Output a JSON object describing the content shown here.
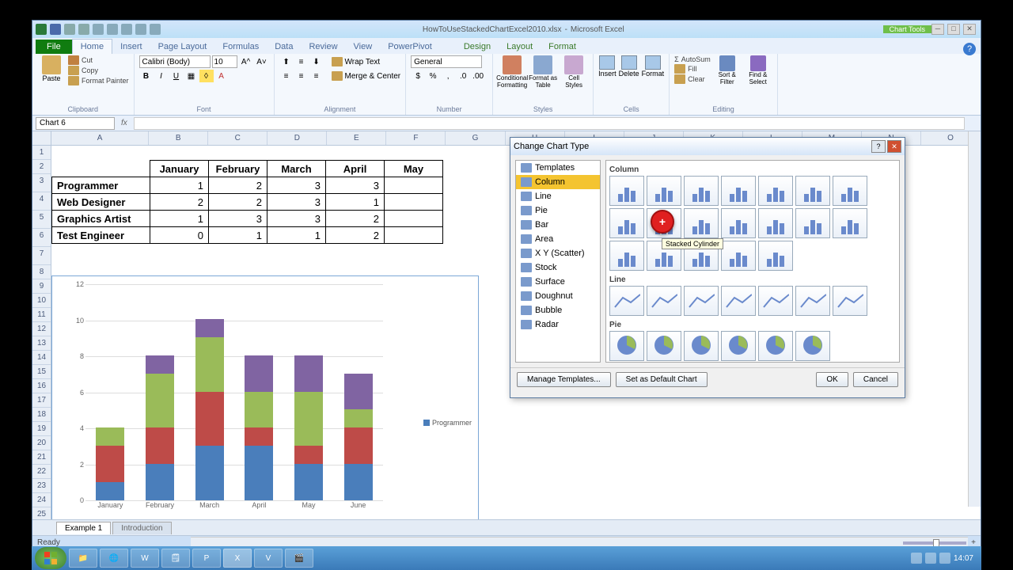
{
  "app": {
    "filename": "HowToUseStackedChartExcel2010.xlsx",
    "app_name": "Microsoft Excel",
    "context_tab": "Chart Tools"
  },
  "ribbon_tabs": [
    "File",
    "Home",
    "Insert",
    "Page Layout",
    "Formulas",
    "Data",
    "Review",
    "View",
    "PowerPivot"
  ],
  "context_tabs": [
    "Design",
    "Layout",
    "Format"
  ],
  "ribbon": {
    "clipboard": {
      "label": "Clipboard",
      "paste": "Paste",
      "cut": "Cut",
      "copy": "Copy",
      "format_painter": "Format Painter"
    },
    "font": {
      "label": "Font",
      "name": "Calibri (Body)",
      "size": "10"
    },
    "alignment": {
      "label": "Alignment",
      "wrap": "Wrap Text",
      "merge": "Merge & Center"
    },
    "number": {
      "label": "Number",
      "format": "General"
    },
    "styles": {
      "label": "Styles",
      "cond": "Conditional Formatting",
      "table": "Format as Table",
      "cell": "Cell Styles"
    },
    "cells": {
      "label": "Cells",
      "insert": "Insert",
      "delete": "Delete",
      "format": "Format"
    },
    "editing": {
      "label": "Editing",
      "sum": "AutoSum",
      "fill": "Fill",
      "clear": "Clear",
      "sort": "Sort & Filter",
      "find": "Find & Select"
    }
  },
  "name_box": "Chart 6",
  "columns": [
    "A",
    "B",
    "C",
    "D",
    "E",
    "F",
    "G",
    "H",
    "I",
    "J",
    "K",
    "L",
    "M",
    "N",
    "O"
  ],
  "row_count": 28,
  "table": {
    "months": [
      "January",
      "February",
      "March",
      "April",
      "May"
    ],
    "rows": [
      {
        "label": "Programmer",
        "values": [
          1,
          2,
          3,
          3
        ]
      },
      {
        "label": "Web Designer",
        "values": [
          2,
          2,
          3,
          1
        ]
      },
      {
        "label": "Graphics Artist",
        "values": [
          1,
          3,
          3,
          2
        ]
      },
      {
        "label": "Test Engineer",
        "values": [
          0,
          1,
          1,
          2
        ]
      }
    ]
  },
  "chart_data": {
    "type": "bar",
    "stacked": true,
    "categories": [
      "January",
      "February",
      "March",
      "April",
      "May",
      "June"
    ],
    "series": [
      {
        "name": "Programmer",
        "values": [
          1,
          2,
          3,
          3,
          2,
          2
        ],
        "color": "#4a7ebb"
      },
      {
        "name": "Web Designer",
        "values": [
          2,
          2,
          3,
          1,
          1,
          2
        ],
        "color": "#be4b48"
      },
      {
        "name": "Graphics Artist",
        "values": [
          1,
          3,
          3,
          2,
          3,
          1
        ],
        "color": "#9abb59"
      },
      {
        "name": "Test Engineer",
        "values": [
          0,
          1,
          1,
          2,
          2,
          2
        ],
        "color": "#8064a2"
      }
    ],
    "ylabel": "",
    "xlabel": "",
    "ylim": [
      0,
      12
    ],
    "ystep": 2
  },
  "legend_visible": "Programmer",
  "sheet_tabs": [
    "Example 1",
    "Introduction"
  ],
  "status": {
    "ready": "Ready",
    "zoom": "100%"
  },
  "dialog": {
    "title": "Change Chart Type",
    "types": [
      "Templates",
      "Column",
      "Line",
      "Pie",
      "Bar",
      "Area",
      "X Y (Scatter)",
      "Stock",
      "Surface",
      "Doughnut",
      "Bubble",
      "Radar"
    ],
    "selected_type": "Column",
    "sections": [
      "Column",
      "Line",
      "Pie"
    ],
    "tooltip": "Stacked Cylinder",
    "manage": "Manage Templates...",
    "default": "Set as Default Chart",
    "ok": "OK",
    "cancel": "Cancel"
  },
  "taskbar": {
    "time": "14:07"
  }
}
